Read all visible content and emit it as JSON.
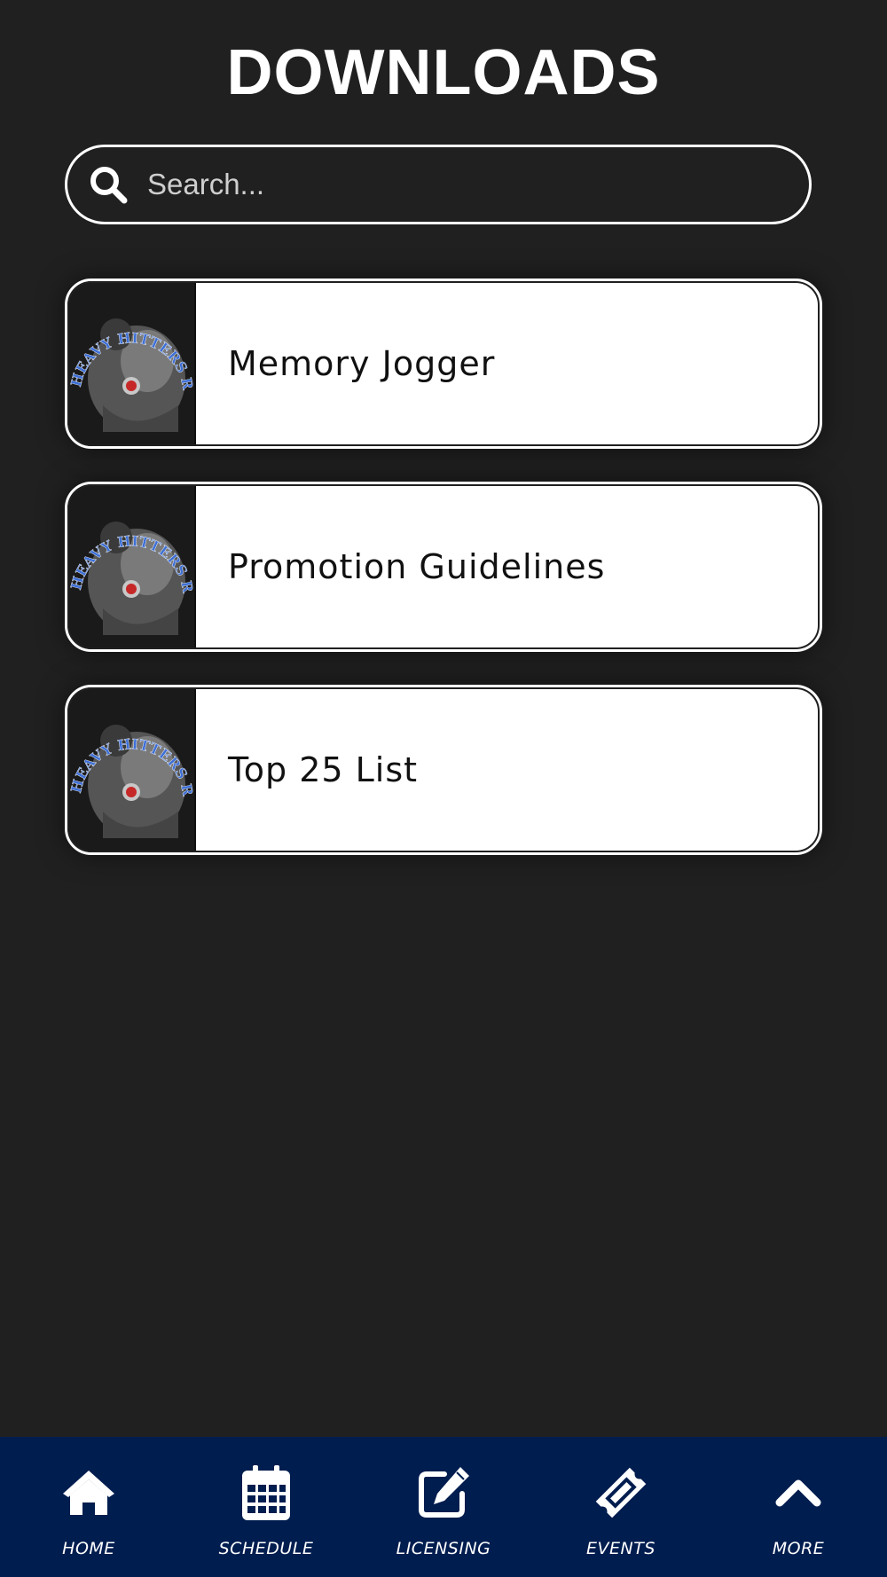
{
  "page": {
    "title": "DOWNLOADS"
  },
  "search": {
    "placeholder": "Search..."
  },
  "downloads": [
    {
      "label": "Memory Jogger",
      "thumbnail": "HEAVY HITTERS REALM"
    },
    {
      "label": "Promotion Guidelines",
      "thumbnail": "HEAVY HITTERS REALM"
    },
    {
      "label": "Top 25 List",
      "thumbnail": "HEAVY HITTERS REALM"
    }
  ],
  "nav": [
    {
      "label": "HOME",
      "icon": "home-icon"
    },
    {
      "label": "SCHEDULE",
      "icon": "calendar-icon"
    },
    {
      "label": "LICENSING",
      "icon": "edit-icon"
    },
    {
      "label": "EVENTS",
      "icon": "ticket-icon"
    },
    {
      "label": "MORE",
      "icon": "chevron-up-icon"
    }
  ],
  "colors": {
    "background": "#202020",
    "nav_background": "#001d4f",
    "card": "#ffffff"
  }
}
